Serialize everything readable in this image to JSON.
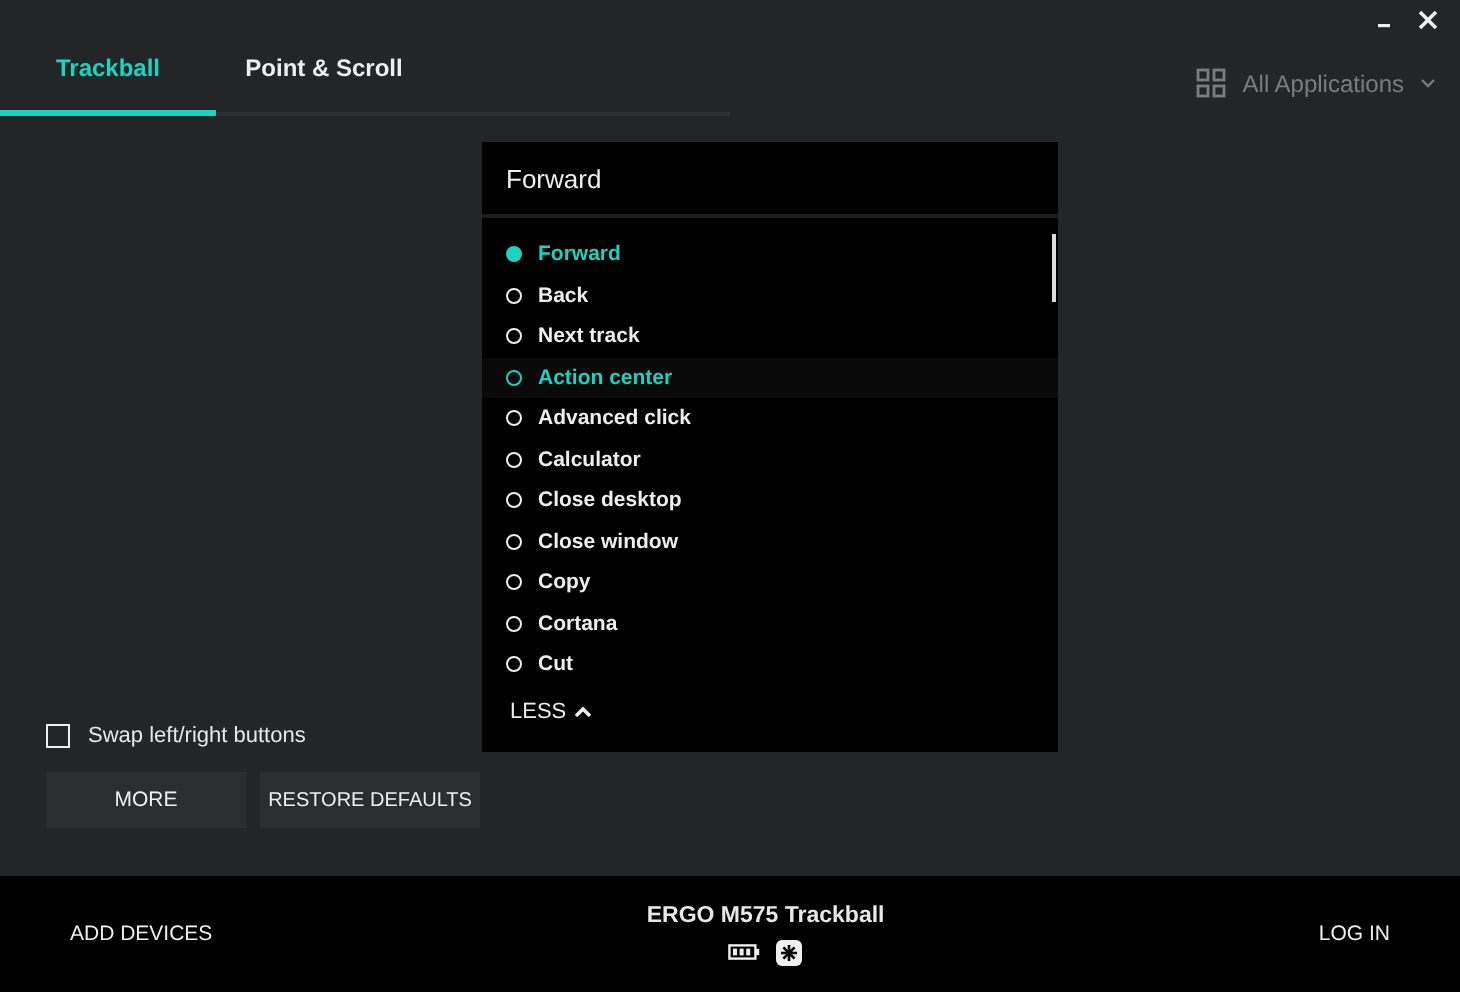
{
  "tabs": [
    {
      "label": "Trackball",
      "selected": true
    },
    {
      "label": "Point & Scroll",
      "selected": false
    }
  ],
  "app_selector": {
    "label": "All Applications"
  },
  "options": [
    {
      "label": "Swap left/right buttons",
      "checked": false
    }
  ],
  "buttons": [
    "MORE",
    "RESTORE DEFAULTS"
  ],
  "action_menu": {
    "title": "Forward",
    "items": [
      {
        "label": "Forward",
        "selected": true,
        "hovered": false
      },
      {
        "label": "Back",
        "selected": false,
        "hovered": false
      },
      {
        "label": "Next track",
        "selected": false,
        "hovered": false
      },
      {
        "label": "Action center",
        "selected": false,
        "hovered": true
      },
      {
        "label": "Advanced click",
        "selected": false,
        "hovered": false
      },
      {
        "label": "Calculator",
        "selected": false,
        "hovered": false
      },
      {
        "label": "Close desktop",
        "selected": false,
        "hovered": false
      },
      {
        "label": "Close window",
        "selected": false,
        "hovered": false
      },
      {
        "label": "Copy",
        "selected": false,
        "hovered": false
      },
      {
        "label": "Cortana",
        "selected": false,
        "hovered": false
      },
      {
        "label": "Cut",
        "selected": false,
        "hovered": false
      }
    ],
    "toggle": "LESS"
  },
  "footer": {
    "left": "ADD DEVICES",
    "device": "ERGO M575 Trackball",
    "right": "LOG IN"
  }
}
